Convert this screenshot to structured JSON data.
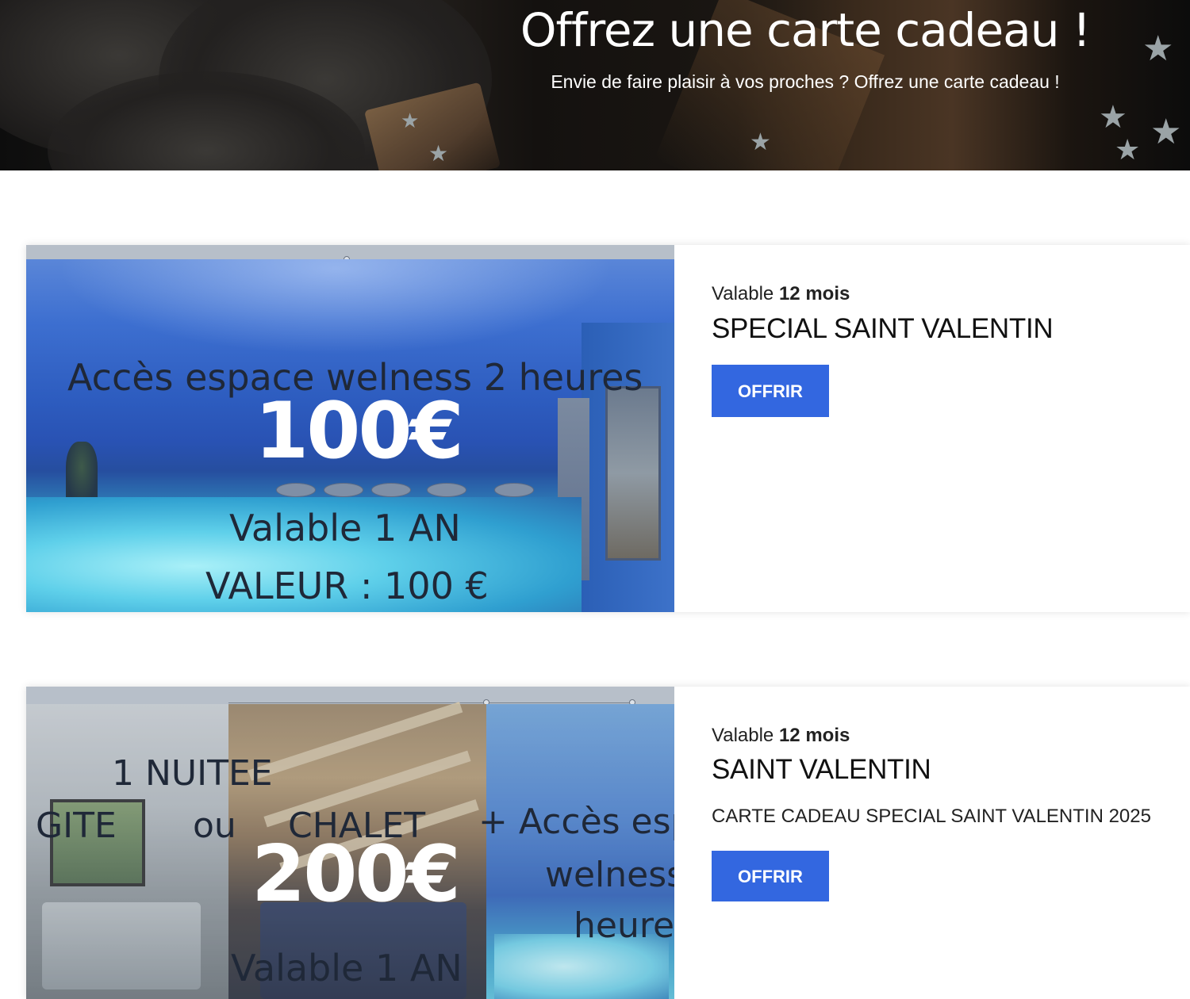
{
  "hero": {
    "title": "Offrez une carte cadeau !",
    "subtitle": "Envie de faire plaisir à vos proches ? Offrez une carte cadeau !"
  },
  "cards": [
    {
      "validity_prefix": "Valable",
      "validity_value": "12 mois",
      "title": "SPECIAL SAINT VALENTIN",
      "button_label": "OFFRIR",
      "image_text": {
        "line1": "Accès espace welness 2 heures",
        "price": "100€",
        "line2": "Valable 1 AN",
        "line3": "VALEUR : 100 €"
      }
    },
    {
      "validity_prefix": "Valable",
      "validity_value": "12 mois",
      "title": "SAINT VALENTIN",
      "description": "CARTE CADEAU SPECIAL SAINT VALENTIN 2025",
      "button_label": "OFFRIR",
      "image_text": {
        "line1": "1 NUITEE",
        "line2_a": "GITE",
        "line2_b": "ou",
        "line2_c": "CHALET",
        "line2_d": "+ Accès esp",
        "line3": "welness",
        "line4": "heure",
        "price": "200€",
        "line5": "Valable 1 AN"
      }
    }
  ],
  "colors": {
    "button": "#3367e0",
    "hero_text": "#ffffff"
  }
}
